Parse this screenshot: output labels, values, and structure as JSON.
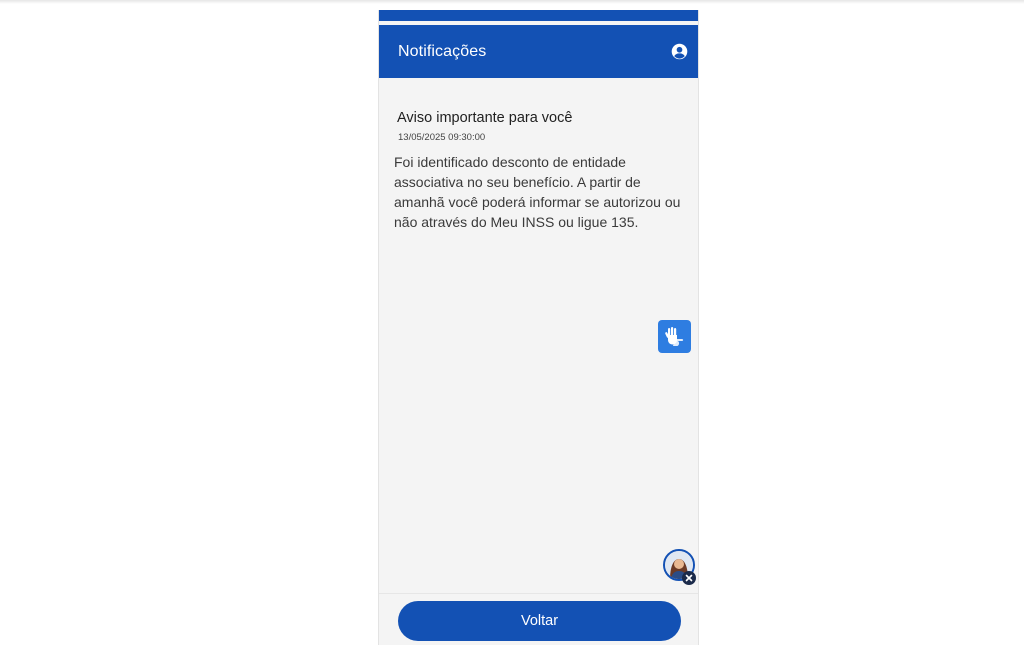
{
  "header": {
    "title": "Notificações",
    "account_icon": "account-circle-icon"
  },
  "notification": {
    "title": "Aviso importante para você",
    "timestamp": "13/05/2025 09:30:00",
    "body": "Foi identificado desconto de entidade associativa no seu benefício. A partir de amanhã você poderá informar se autorizou ou não através do Meu INSS ou ligue 135."
  },
  "floating": {
    "libras_icon": "sign-language-hands-icon",
    "assistant_icon": "virtual-assistant-avatar",
    "close_icon": "close-icon"
  },
  "footer": {
    "back_label": "Voltar"
  },
  "colors": {
    "primary": "#1351b4",
    "libras_button": "#2e7de1",
    "background": "#f4f4f4"
  }
}
